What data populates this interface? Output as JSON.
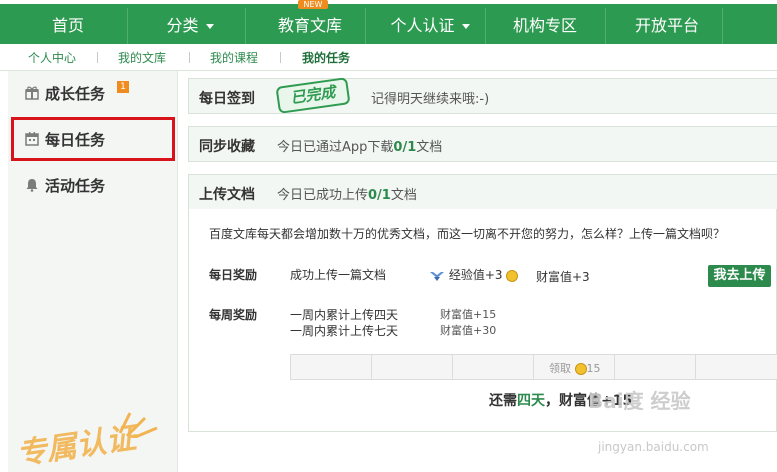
{
  "topnav": {
    "items": [
      "首页",
      "分类",
      "教育文库",
      "个人认证",
      "机构专区",
      "开放平台"
    ],
    "new_badge": "NEW"
  },
  "subnav": {
    "items": [
      "个人中心",
      "我的文库",
      "我的课程",
      "我的任务"
    ]
  },
  "sidebar": {
    "items": [
      {
        "label": "成长任务",
        "icon": "gift-icon",
        "badge": "1"
      },
      {
        "label": "每日任务",
        "icon": "calendar-icon"
      },
      {
        "label": "活动任务",
        "icon": "bell-icon"
      }
    ],
    "stamp": "专属认证"
  },
  "cards": {
    "checkin": {
      "title": "每日签到",
      "stamp": "已完成",
      "message": "记得明天继续来哦:-)"
    },
    "sync": {
      "title": "同步收藏",
      "msg_prefix": "今日已通过App下载",
      "count": "0/1",
      "msg_suffix": "文档"
    },
    "upload": {
      "title": "上传文档",
      "msg_prefix": "今日已成功上传",
      "count": "0/1",
      "msg_suffix": "文档",
      "description": "百度文库每天都会增加数十万的优秀文档，而这一切离不开您的努力，怎么样？上传一篇文档呗？",
      "daily_label": "每日奖励",
      "daily_task": "成功上传一篇文档",
      "daily_exp": "经验值+3",
      "daily_wealth": "财富值+3",
      "button": "我去上传",
      "weekly_label": "每周奖励",
      "weekly_tasks": [
        "一周内累计上传四天",
        "一周内累计上传七天"
      ],
      "weekly_rewards": [
        "财富值+15",
        "财富值+30"
      ],
      "claim_label": "领取",
      "claim_amount": "15",
      "need_prefix": "还需",
      "need_days": "四天",
      "need_suffix": "，财富值+15"
    }
  },
  "watermark": {
    "brand": "Bai度 经验",
    "url": "jingyan.baidu.com"
  },
  "colors": {
    "brand_green": "#2c9a50",
    "highlight_red": "#d9131a",
    "badge_orange": "#f08c1f"
  }
}
